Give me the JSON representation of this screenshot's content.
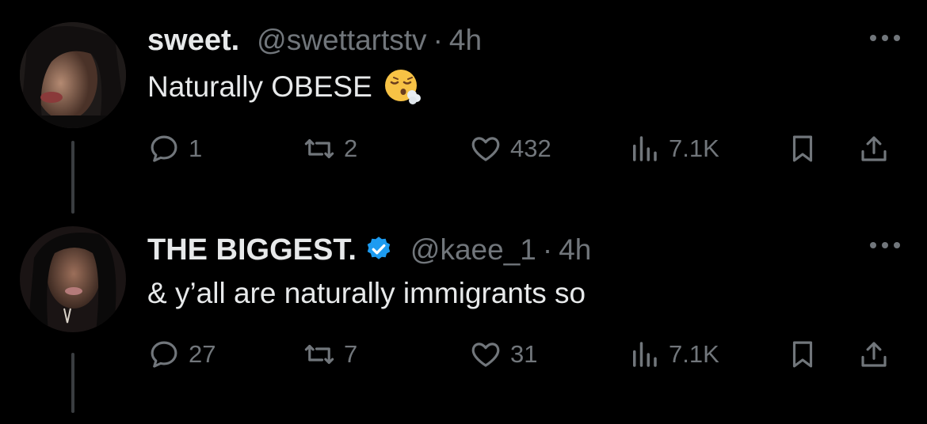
{
  "tweets": [
    {
      "name": "sweet.",
      "handle": "@swettartstv",
      "separator": "·",
      "time": "4h",
      "text": "Naturally OBESE",
      "emoji": "face-exhaling-emoji",
      "verified": false,
      "actions": {
        "replies": "1",
        "reposts": "2",
        "likes": "432",
        "views": "7.1K"
      }
    },
    {
      "name": "THE BIGGEST.",
      "handle": "@kaee_1",
      "separator": "·",
      "time": "4h",
      "text": "& y’all are naturally immigrants so",
      "verified": true,
      "actions": {
        "replies": "27",
        "reposts": "7",
        "likes": "31",
        "views": "7.1K"
      }
    }
  ],
  "colors": {
    "background": "#000000",
    "primary_text": "#e7e9ea",
    "secondary_text": "#71767b",
    "verified": "#1d9bf0",
    "thread_line": "#3a3d40"
  }
}
